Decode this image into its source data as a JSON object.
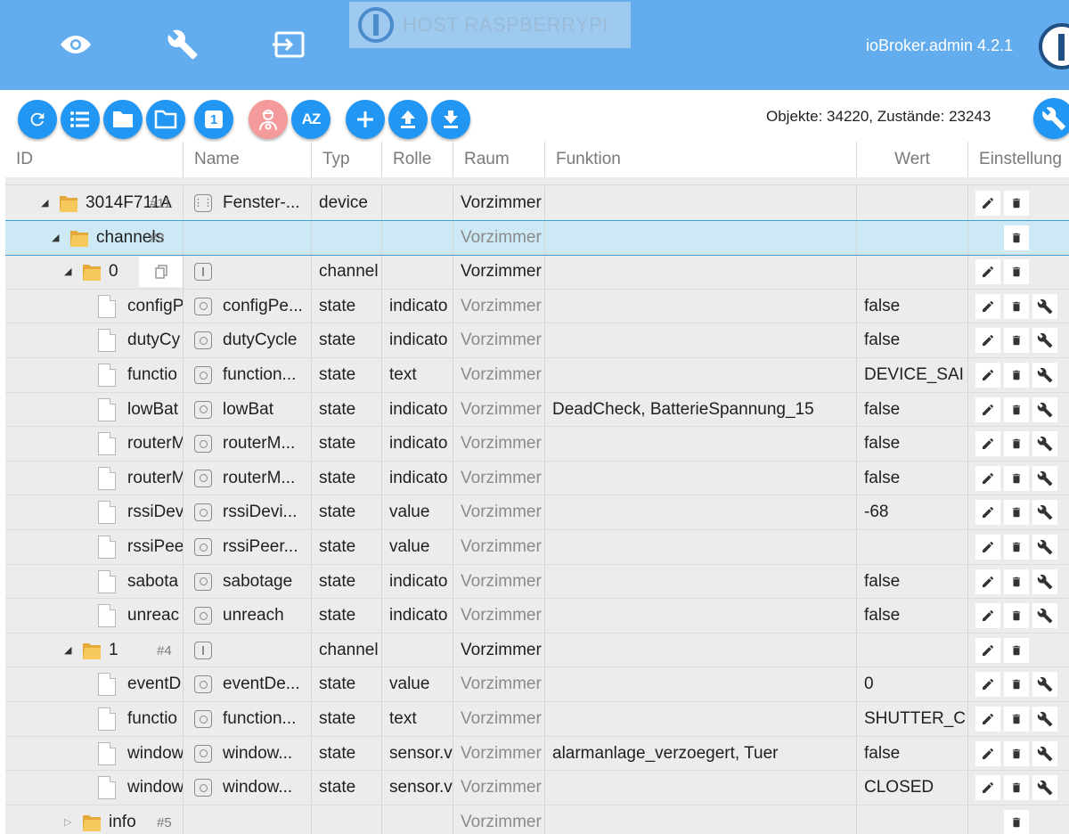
{
  "header": {
    "host_label": "HOST RASPBERRYPI",
    "version": "ioBroker.admin 4.2.1",
    "nav": [
      {
        "name": "eye-icon"
      },
      {
        "name": "wrench-icon"
      },
      {
        "name": "logout-icon"
      }
    ]
  },
  "toolbar": {
    "buttons": [
      {
        "name": "refresh-button",
        "icon": "refresh-icon"
      },
      {
        "name": "list-view-button",
        "icon": "list-icon"
      },
      {
        "name": "folder-expand-button",
        "icon": "folder-filled-icon"
      },
      {
        "name": "folder-collapse-button",
        "icon": "folder-outline-icon"
      },
      {
        "name": "expand-level-button",
        "icon": "number-one-icon",
        "text": "1"
      },
      {
        "name": "expert-mode-button",
        "icon": "expert-icon"
      },
      {
        "name": "sort-az-button",
        "icon": "sort-az-icon",
        "text": "AZ"
      },
      {
        "name": "add-object-button",
        "icon": "plus-icon"
      },
      {
        "name": "upload-button",
        "icon": "upload-icon"
      },
      {
        "name": "download-button",
        "icon": "download-icon"
      }
    ],
    "counts": "Objekte: 34220, Zustände: 23243",
    "settings_icon": "wrench-icon"
  },
  "columns": [
    "ID",
    "Name",
    "Typ",
    "Rolle",
    "Raum",
    "Funktion",
    "Wert",
    "Einstellung"
  ],
  "rows": [
    {
      "level": 1,
      "kind": "folder",
      "expand": "open",
      "id": "3014F711A",
      "num": "#11",
      "name_icon": "device",
      "name": "Fenster-...",
      "typ": "device",
      "rolle": "",
      "raum": "Vorzimmer",
      "raum_style": "dark",
      "funktion": "",
      "wert": "",
      "actions": [
        "edit",
        "delete"
      ]
    },
    {
      "level": 2,
      "kind": "folder",
      "expand": "open",
      "id": "channels",
      "num": "#3",
      "name_icon": "",
      "name": "",
      "typ": "",
      "rolle": "",
      "raum": "Vorzimmer",
      "raum_style": "grey",
      "funktion": "",
      "wert": "",
      "actions": [
        "delete"
      ],
      "selected": true
    },
    {
      "level": 3,
      "kind": "folder",
      "expand": "open",
      "id": "0",
      "num": "",
      "copy": true,
      "name_icon": "channel",
      "name": "",
      "typ": "channel",
      "rolle": "",
      "raum": "Vorzimmer",
      "raum_style": "dark",
      "funktion": "",
      "wert": "",
      "actions": [
        "edit",
        "delete"
      ]
    },
    {
      "level": 4,
      "kind": "doc",
      "id": "configP",
      "name_icon": "state",
      "name": "configPe...",
      "typ": "state",
      "rolle": "indicato",
      "raum": "Vorzimmer",
      "raum_style": "grey",
      "funktion": "",
      "wert": "false",
      "actions": [
        "edit",
        "delete",
        "wrench"
      ]
    },
    {
      "level": 4,
      "kind": "doc",
      "id": "dutyCy",
      "name_icon": "state",
      "name": "dutyCycle",
      "typ": "state",
      "rolle": "indicato",
      "raum": "Vorzimmer",
      "raum_style": "grey",
      "funktion": "",
      "wert": "false",
      "actions": [
        "edit",
        "delete",
        "wrench"
      ]
    },
    {
      "level": 4,
      "kind": "doc",
      "id": "functio",
      "name_icon": "state",
      "name": "function...",
      "typ": "state",
      "rolle": "text",
      "raum": "Vorzimmer",
      "raum_style": "grey",
      "funktion": "",
      "wert": "DEVICE_SAI",
      "actions": [
        "edit",
        "delete",
        "wrench"
      ]
    },
    {
      "level": 4,
      "kind": "doc",
      "id": "lowBat",
      "name_icon": "state",
      "name": "lowBat",
      "typ": "state",
      "rolle": "indicato",
      "raum": "Vorzimmer",
      "raum_style": "grey",
      "funktion": "DeadCheck, BatterieSpannung_15",
      "wert": "false",
      "actions": [
        "edit",
        "delete",
        "wrench"
      ]
    },
    {
      "level": 4,
      "kind": "doc",
      "id": "routerM",
      "name_icon": "state",
      "name": "routerM...",
      "typ": "state",
      "rolle": "indicato",
      "raum": "Vorzimmer",
      "raum_style": "grey",
      "funktion": "",
      "wert": "false",
      "actions": [
        "edit",
        "delete",
        "wrench"
      ]
    },
    {
      "level": 4,
      "kind": "doc",
      "id": "routerM",
      "name_icon": "state",
      "name": "routerM...",
      "typ": "state",
      "rolle": "indicato",
      "raum": "Vorzimmer",
      "raum_style": "grey",
      "funktion": "",
      "wert": "false",
      "actions": [
        "edit",
        "delete",
        "wrench"
      ]
    },
    {
      "level": 4,
      "kind": "doc",
      "id": "rssiDev",
      "name_icon": "state",
      "name": "rssiDevi...",
      "typ": "state",
      "rolle": "value",
      "raum": "Vorzimmer",
      "raum_style": "grey",
      "funktion": "",
      "wert": "-68",
      "actions": [
        "edit",
        "delete",
        "wrench"
      ]
    },
    {
      "level": 4,
      "kind": "doc",
      "id": "rssiPee",
      "name_icon": "state",
      "name": "rssiPeer...",
      "typ": "state",
      "rolle": "value",
      "raum": "Vorzimmer",
      "raum_style": "grey",
      "funktion": "",
      "wert": "",
      "actions": [
        "edit",
        "delete",
        "wrench"
      ]
    },
    {
      "level": 4,
      "kind": "doc",
      "id": "sabota",
      "name_icon": "state",
      "name": "sabotage",
      "typ": "state",
      "rolle": "indicato",
      "raum": "Vorzimmer",
      "raum_style": "grey",
      "funktion": "",
      "wert": "false",
      "actions": [
        "edit",
        "delete",
        "wrench"
      ]
    },
    {
      "level": 4,
      "kind": "doc",
      "id": "unreac",
      "name_icon": "state",
      "name": "unreach",
      "typ": "state",
      "rolle": "indicato",
      "raum": "Vorzimmer",
      "raum_style": "grey",
      "funktion": "",
      "wert": "false",
      "actions": [
        "edit",
        "delete",
        "wrench"
      ]
    },
    {
      "level": 3,
      "kind": "folder",
      "expand": "open",
      "id": "1",
      "num": "#4",
      "name_icon": "channel",
      "name": "",
      "typ": "channel",
      "rolle": "",
      "raum": "Vorzimmer",
      "raum_style": "dark",
      "funktion": "",
      "wert": "",
      "actions": [
        "edit",
        "delete"
      ]
    },
    {
      "level": 4,
      "kind": "doc",
      "id": "eventD",
      "name_icon": "state",
      "name": "eventDe...",
      "typ": "state",
      "rolle": "value",
      "raum": "Vorzimmer",
      "raum_style": "grey",
      "funktion": "",
      "wert": "0",
      "actions": [
        "edit",
        "delete",
        "wrench"
      ]
    },
    {
      "level": 4,
      "kind": "doc",
      "id": "functio",
      "name_icon": "state",
      "name": "function...",
      "typ": "state",
      "rolle": "text",
      "raum": "Vorzimmer",
      "raum_style": "grey",
      "funktion": "",
      "wert": "SHUTTER_C",
      "actions": [
        "edit",
        "delete",
        "wrench"
      ]
    },
    {
      "level": 4,
      "kind": "doc",
      "id": "window",
      "name_icon": "state",
      "name": "window...",
      "typ": "state",
      "rolle": "sensor.v",
      "raum": "Vorzimmer",
      "raum_style": "grey",
      "funktion": "alarmanlage_verzoegert, Tuer",
      "wert": "false",
      "actions": [
        "edit",
        "delete",
        "wrench"
      ]
    },
    {
      "level": 4,
      "kind": "doc",
      "id": "window",
      "name_icon": "state",
      "name": "window...",
      "typ": "state",
      "rolle": "sensor.v",
      "raum": "Vorzimmer",
      "raum_style": "grey",
      "funktion": "",
      "wert": "CLOSED",
      "actions": [
        "edit",
        "delete",
        "wrench"
      ]
    },
    {
      "level": 3,
      "kind": "folder",
      "expand": "closed",
      "id": "info",
      "num": "#5",
      "name_icon": "",
      "name": "",
      "typ": "",
      "rolle": "",
      "raum": "Vorzimmer",
      "raum_style": "grey",
      "funktion": "",
      "wert": "",
      "actions": [
        "delete"
      ]
    }
  ]
}
